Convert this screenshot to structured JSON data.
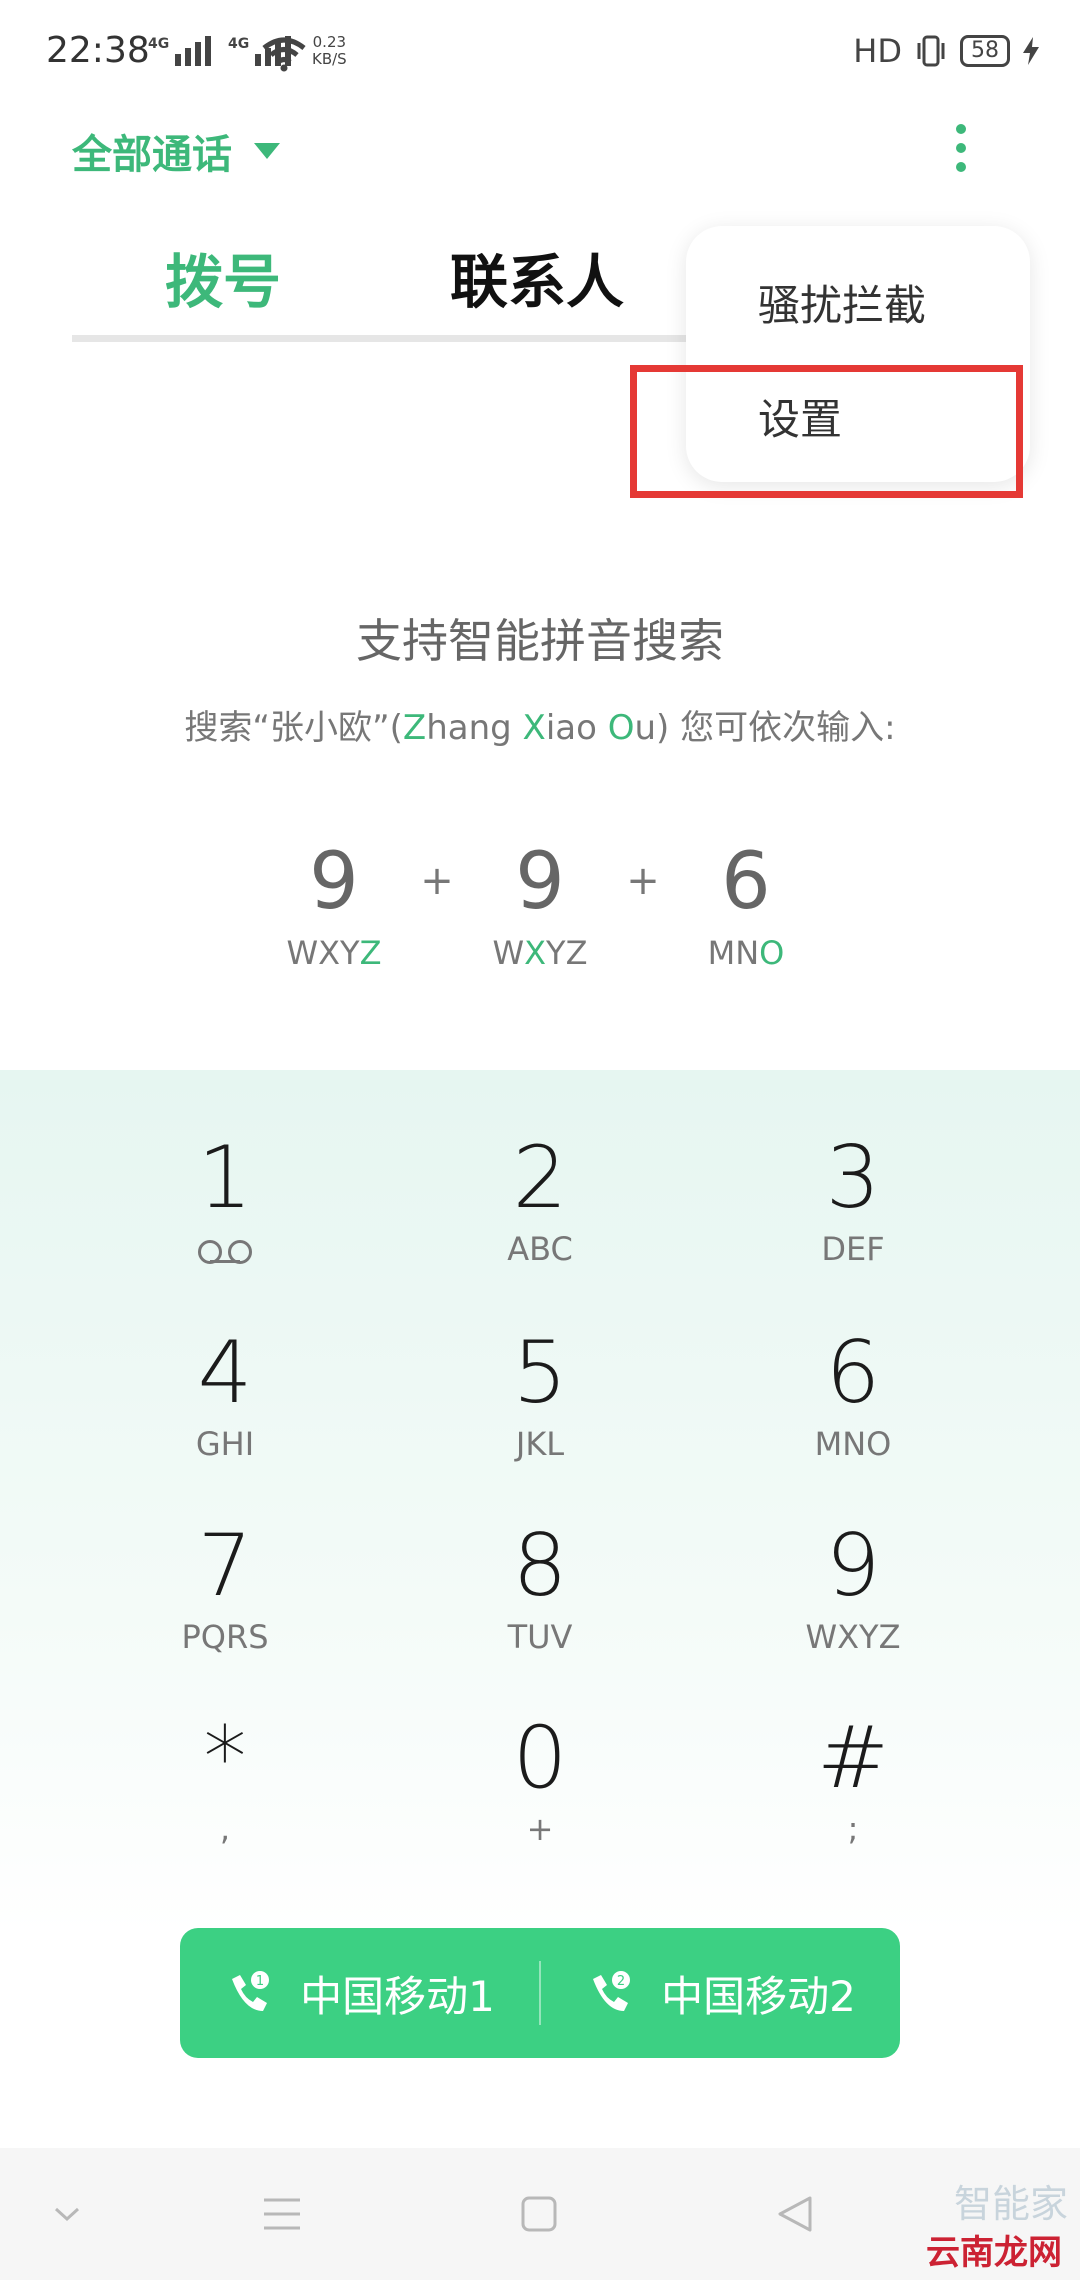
{
  "status": {
    "time": "22:38",
    "net1": "4G",
    "net2": "4G",
    "speed_value": "0.23",
    "speed_unit": "KB/S",
    "hd": "HD",
    "battery": "58"
  },
  "header": {
    "filter_label": "全部通话",
    "more_icon": "more-vert-icon"
  },
  "tabs": {
    "dial": "拨号",
    "contacts": "联系人"
  },
  "menu": {
    "items": [
      "骚扰拦截",
      "设置"
    ],
    "highlighted": "设置",
    "highlight_color": "#e53935"
  },
  "hint": {
    "title": "支持智能拼音搜索",
    "sub_prefix": "搜索“张小欧”(",
    "sub_z": "Z",
    "sub_hang": "hang ",
    "sub_x": "X",
    "sub_iao": "iao ",
    "sub_o": "O",
    "sub_u": "u",
    "sub_suffix": ") 您可依次输入:",
    "sequence": [
      {
        "digit": "9",
        "letters_plain": "WXY",
        "letters_hl": "Z",
        "letters_after": ""
      },
      {
        "digit": "9",
        "letters_plain": "W",
        "letters_hl": "X",
        "letters_after": "YZ"
      },
      {
        "digit": "6",
        "letters_plain": "MN",
        "letters_hl": "O",
        "letters_after": ""
      }
    ],
    "plus": "+"
  },
  "keypad": [
    {
      "num": "1",
      "letters": ""
    },
    {
      "num": "2",
      "letters": "ABC"
    },
    {
      "num": "3",
      "letters": "DEF"
    },
    {
      "num": "4",
      "letters": "GHI"
    },
    {
      "num": "5",
      "letters": "JKL"
    },
    {
      "num": "6",
      "letters": "MNO"
    },
    {
      "num": "7",
      "letters": "PQRS"
    },
    {
      "num": "8",
      "letters": "TUV"
    },
    {
      "num": "9",
      "letters": "WXYZ"
    },
    {
      "num": "*",
      "letters": ","
    },
    {
      "num": "0",
      "letters": "+"
    },
    {
      "num": "#",
      "letters": ";"
    }
  ],
  "call": {
    "sim1": "中国移动1",
    "sim2": "中国移动2",
    "sim1_badge": "1",
    "sim2_badge": "2"
  },
  "nav": {
    "icons": [
      "chevron-down-icon",
      "menu-icon",
      "home-square-icon",
      "back-triangle-icon"
    ]
  },
  "watermark": {
    "text": "云南龙网",
    "faint": "智能家"
  },
  "colors": {
    "accent": "#3db87a",
    "call_button": "#3cd083"
  }
}
